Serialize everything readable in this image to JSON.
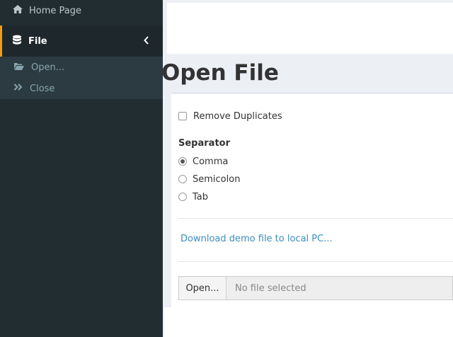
{
  "sidebar": {
    "home_label": "Home Page",
    "file_label": "File",
    "submenu": {
      "open_label": "Open...",
      "close_label": "Close"
    }
  },
  "page": {
    "title": "Open File"
  },
  "form": {
    "remove_duplicates_label": "Remove Duplicates",
    "remove_duplicates_checked": false,
    "separator_label": "Separator",
    "separator_options": [
      "Comma",
      "Semicolon",
      "Tab"
    ],
    "separator_selected": "Comma",
    "download_link_text": "Download demo file to local PC...",
    "browse_button_label": "Open...",
    "file_placeholder": "No file selected"
  },
  "colors": {
    "sidebar_bg": "#222d32",
    "active_accent": "#f39c12",
    "link": "#3c8dbc"
  },
  "icons": {
    "home": "home-icon",
    "file": "database-icon",
    "open": "folder-open-icon",
    "close": "double-chevron-right-icon",
    "collapse": "chevron-left-icon"
  }
}
